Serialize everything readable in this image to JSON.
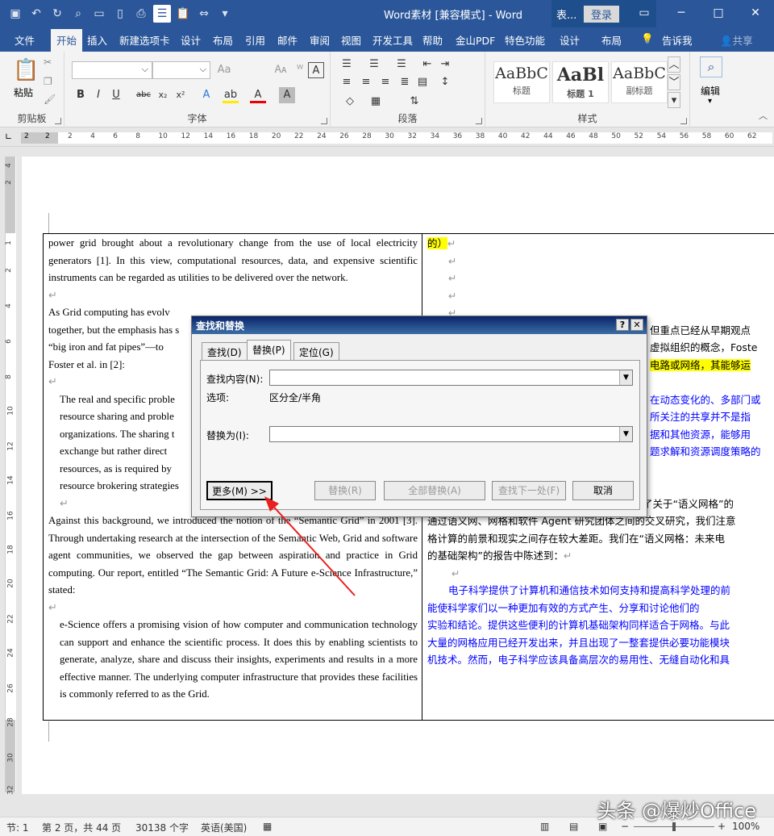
{
  "titlebar": {
    "title": "Word素材 [兼容模式] - Word",
    "context_tab": "表...",
    "login": "登录",
    "qat_icons": [
      "save-icon",
      "undo-icon",
      "redo-icon",
      "print-preview-icon",
      "open-icon",
      "new-icon",
      "print-icon",
      "paste-icon",
      "format-icon",
      "touch-mode-icon",
      "customize-icon"
    ]
  },
  "tabs": [
    "文件",
    "开始",
    "插入",
    "新建选项卡",
    "设计",
    "布局",
    "引用",
    "邮件",
    "审阅",
    "视图",
    "开发工具",
    "帮助",
    "金山PDF",
    "特色功能",
    "设计",
    "布局",
    "告诉我",
    "共享"
  ],
  "ribbon": {
    "clipboard": {
      "label": "剪贴板",
      "paste": "粘贴"
    },
    "font": {
      "label": "字体",
      "name": "",
      "size": ""
    },
    "paragraph": {
      "label": "段落"
    },
    "styles": {
      "label": "样式",
      "items": [
        {
          "sample": "AaBbC",
          "name": "标题"
        },
        {
          "sample": "AaBl",
          "name": "标题 1"
        },
        {
          "sample": "AaBbC",
          "name": "副标题"
        }
      ]
    },
    "editing": {
      "label": "编辑"
    }
  },
  "ruler": {
    "left_marks": [
      "2",
      "",
      "2"
    ],
    "ticks": [
      "2",
      "4",
      "6",
      "8",
      "10",
      "12",
      "14",
      "16",
      "18",
      "20",
      "22",
      "24",
      "26",
      "28",
      "30",
      "32",
      "34",
      "36",
      "38",
      "40",
      "42",
      "44",
      "46",
      "48",
      "50",
      "52",
      "54",
      "56",
      "58",
      "60",
      "62"
    ],
    "v_ticks": [
      "4",
      "2",
      "",
      "1",
      "2",
      "4",
      "6",
      "8",
      "10",
      "12",
      "14",
      "16",
      "18",
      "20",
      "22",
      "24",
      "26",
      "28",
      "30",
      "32"
    ]
  },
  "document": {
    "left_para1": "power grid brought about a revolutionary change from the use of local electricity generators [1]. In this view, computational resources, data, and expensive scientific instruments can be regarded as utilities to be delivered over the network.",
    "left_para2": "As Grid computing has evolv... together, but the emphasis has s... “big iron and fat pipes”—to ... Foster et al. in [2]:",
    "left_para2_lines": [
      "As Grid computing has evolv",
      "together, but the emphasis has s",
      "“big iron and fat pipes”—to",
      "Foster et al. in [2]:"
    ],
    "left_quote_lines": [
      "The real and specific proble",
      "resource sharing and proble",
      "organizations. The sharing t",
      "exchange but rather direct",
      "resources, as is required by",
      "resource brokering strategies"
    ],
    "left_para3": "Against this background, we introduced the notion of the “Semantic Grid” in 2001 [3]. Through undertaking research at the intersection of the Semantic Web, Grid and software agent communities, we observed the gap between aspiration and practice in Grid computing. Our report, entitled “The Semantic Grid: A Future e-Science Infrastructure,” stated:",
    "left_quote2": "e-Science offers a promising vision of how computer and communication technology can support and enhance the scientific process. It does this by enabling scientists to generate, analyze, share and discuss their insights, experiments and results in a more effective manner. The underlying computer infrastructure that provides these facilities is commonly referred to as the Grid.",
    "pilcrow": "↵",
    "right_first": "的）",
    "right_lines_a": [
      "但重点已经从早期观点",
      "虚拟组织的概念，Foste"
    ],
    "right_line_hl": "电路或网络，其能够运",
    "right_blue_a": [
      "在动态变化的、多部门或",
      "所关注的共享并不是指",
      "据和其他资源，能够用",
      "题求解和资源调度策略的"
    ],
    "right_para3": [
      "在这种背景下，2001 发表的论文[3]中介绍了关于“语义网格”的",
      "通过语义网、网格和软件 Agent 研究团体之间的交叉研究，我们注意",
      "格计算的前景和现实之间存在较大差距。我们在“语义网格：未来电",
      "的基础架构”的报告中陈述到："
    ],
    "right_blue_b": [
      "电子科学提供了计算机和通信技术如何支持和提高科学处理的前",
      "能使科学家们以一种更加有效的方式产生、分享和讨论他们的",
      "实验和结论。提供这些便利的计算机基础架构同样适合于网格。与此",
      "大量的网格应用已经开发出来，并且出现了一整套提供必要功能模块",
      "机技术。然而，电子科学应该具备高层次的易用性、无缝自动化和具"
    ]
  },
  "dialog": {
    "title": "查找和替换",
    "help": "?",
    "close": "✕",
    "tabs": [
      "查找(D)",
      "替换(P)",
      "定位(G)"
    ],
    "find_label": "查找内容(N):",
    "find_value": "",
    "options_label": "选项:",
    "options_value": "区分全/半角",
    "replace_label": "替换为(I):",
    "replace_value": "",
    "buttons": {
      "more": "更多(M) >>",
      "replace": "替换(R)",
      "replace_all": "全部替换(A)",
      "find_next": "查找下一处(F)",
      "cancel": "取消"
    }
  },
  "status": {
    "section": "节: 1",
    "page": "第 2 页，共 44 页",
    "words": "30138 个字",
    "language": "英语(美国)",
    "zoom": "100%"
  },
  "watermark": "头条 @爆炒Office"
}
